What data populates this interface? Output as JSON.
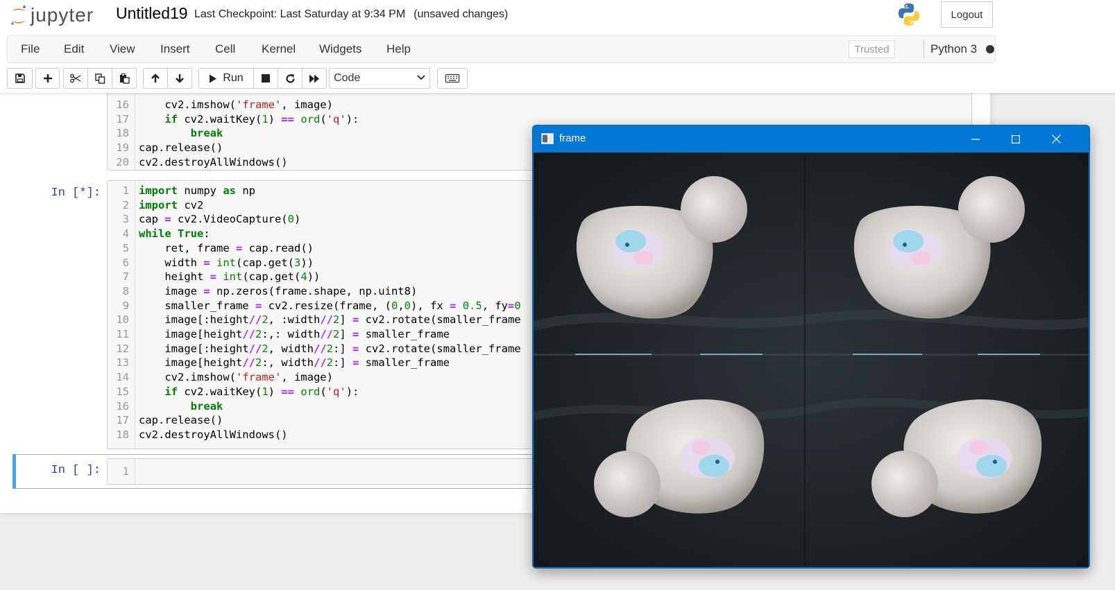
{
  "header": {
    "logo_text": "jupyter",
    "notebook_name": "Untitled19",
    "checkpoint": "Last Checkpoint: Last Saturday at 9:34 PM",
    "unsaved": "(unsaved changes)",
    "logout_label": "Logout"
  },
  "menubar": {
    "items": [
      "File",
      "Edit",
      "View",
      "Insert",
      "Cell",
      "Kernel",
      "Widgets",
      "Help"
    ],
    "trusted_label": "Trusted",
    "kernel_name": "Python 3"
  },
  "toolbar": {
    "run_label": "Run",
    "cell_type": "Code",
    "icons": [
      "save-icon",
      "plus-icon",
      "cut-icon",
      "copy-icon",
      "paste-icon",
      "arrow-up-icon",
      "arrow-down-icon",
      "play-icon",
      "stop-icon",
      "restart-icon",
      "fast-forward-icon",
      "keyboard-icon"
    ]
  },
  "cells": [
    {
      "prompt": "",
      "line_numbers": [
        "16",
        "17",
        "18",
        "19",
        "20"
      ],
      "lines": [
        "    cv2.imshow('frame', image)",
        "    if cv2.waitKey(1) == ord('q'):",
        "        break",
        "cap.release()",
        "cv2.destroyAllWindows()"
      ]
    },
    {
      "prompt": "In [*]:",
      "line_numbers": [
        "1",
        "2",
        "3",
        "4",
        "5",
        "6",
        "7",
        "8",
        "9",
        "10",
        "11",
        "12",
        "13",
        "14",
        "15",
        "16",
        "17",
        "18"
      ],
      "lines": [
        "import numpy as np",
        "import cv2",
        "cap = cv2.VideoCapture(0)",
        "while True:",
        "    ret, frame = cap.read()",
        "    width = int(cap.get(3))",
        "    height = int(cap.get(4))",
        "    image = np.zeros(frame.shape, np.uint8)",
        "    smaller_frame = cv2.resize(frame, (0,0), fx = 0.5, fy=0",
        "    image[:height//2, :width//2] = cv2.rotate(smaller_frame",
        "    image[height//2:,: width//2] = smaller_frame",
        "    image[:height//2, width//2:] = cv2.rotate(smaller_frame",
        "    image[height//2:, width//2:] = smaller_frame",
        "    cv2.imshow('frame', image)",
        "    if cv2.waitKey(1) == ord('q'):",
        "        break",
        "cap.release()",
        "cv2.destroyAllWindows()"
      ]
    },
    {
      "prompt": "In [ ]:",
      "line_numbers": [
        "1"
      ],
      "lines": [
        ""
      ]
    }
  ],
  "cv_window": {
    "title": "frame"
  }
}
